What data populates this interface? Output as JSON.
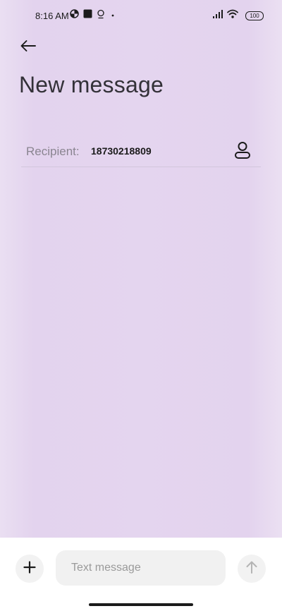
{
  "status_bar": {
    "time": "8:16 AM",
    "battery": "100",
    "icons_left": [
      "data-saver-icon",
      "square-app-icon",
      "location-pin-icon",
      "dot-icon"
    ],
    "icons_right": [
      "signal-icon",
      "wifi-icon",
      "battery-icon"
    ]
  },
  "header": {
    "back_icon": "back-arrow-icon",
    "title": "New message"
  },
  "recipient": {
    "label": "Recipient:",
    "value": "18730218809",
    "contact_icon": "person-icon"
  },
  "composer": {
    "add_icon": "plus-icon",
    "placeholder": "Text message",
    "value": "",
    "send_icon": "arrow-up-icon"
  },
  "colors": {
    "background": "#e4d5ef",
    "divider": "#d2c6dc",
    "text_primary": "#1b1b1b",
    "text_secondary": "#8a8590",
    "button_bg": "#f2f2f2"
  }
}
